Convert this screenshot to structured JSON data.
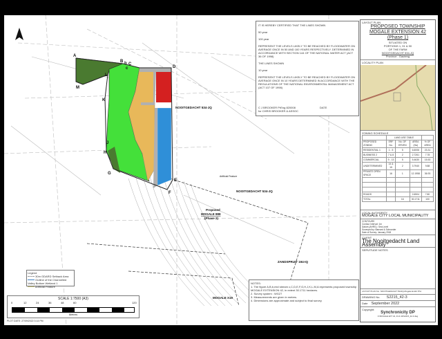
{
  "certificate": {
    "heading": "IT IS HEREBY CERTIFIED THAT THE LINES SHOWN",
    "line_50": "50   year",
    "line_100": "100   year",
    "text1": "REPRESENT THE LEVELS LIKELY TO BE REACHED BY FLOODWATER ON AVERAGE ONCE IN 50 AND 100 YEARS RESPECTIVELY. DETERMINED IN ACCORDANCE WITH SECTION 144 OF THE NATIONAL WATER ACT (ACT 36 OF 1998)",
    "lines_shown": "THE LINES SHOWN",
    "line_10": "10   year",
    "text2": "REPRESENT THE LEVELS LIKELY TO BE REACHED BY FLOODWATER ON AVERAGE ONCE IN 10 YEARS DETERMINED IN ACCORDANCE WITH THE REGULATIONS OF THE NATIONAL ENVIRONMENTAL MANAGEMENT ACT (ACT 107 OF 1998)",
    "signatory": "C J BROOKER PrEng 820008",
    "signatory_firm": "for CHRIS BROOKER & ASSOC",
    "date_label": "DATE"
  },
  "title_block": {
    "layout_plan_label": "LAYOUT PLAN",
    "title1": "PROPOSED TOWNSHIP",
    "title2": "MOGALE EXTENSION 42",
    "phase": "(Phase 1)",
    "situated": "SITUATED ON",
    "portions": "PORTIONS 1, 91 & 90",
    "farm": "OF THE FARM",
    "farm_name": "NOOITGEDACHT 534-JQ",
    "province": "Province : Gauteng",
    "locality_plan_label": "LOCALITY PLAN"
  },
  "zoning": {
    "heading": "ZONING SCHEDULE",
    "group_header": "LAND USE TABLE",
    "columns": [
      "PROPOSED ZONING",
      "ERF No.",
      "No. OF ERVEN",
      "AREA (Ha)",
      "% OF AREA"
    ],
    "rows": [
      [
        "RESIDENTIAL 1",
        "1 - 5",
        "5",
        "6.6006",
        "23.31"
      ],
      [
        "BUSINESS 2",
        "7 & 8",
        "2",
        "2.7261",
        "7.78"
      ],
      [
        "COMMERCIAL",
        "9 - 13",
        "5",
        "5.4630",
        "15.53"
      ],
      [
        "UNDETERMINED",
        "14 & 15",
        "2",
        "3.7940",
        "9.88"
      ],
      [
        "PRIVATE OPEN SPACE",
        "16",
        "1",
        "12.1958",
        "36.93"
      ]
    ],
    "roads": [
      "ROADS",
      "",
      "",
      "2.6504",
      "7.80"
    ],
    "total": [
      "TOTAL",
      "",
      "16",
      "30.1711",
      "100"
    ]
  },
  "authority": {
    "label": "LOCAL AUTHORITY",
    "name": "MOGALE CITY LOCAL MUNICIPALITY",
    "contours_label": "CONTOURS",
    "contour_rows": [
      [
        "Contour Interval:",
        "1m"
      ],
      [
        "Datum (AHRS.):",
        "Sea Level"
      ],
      [
        "Surveyed by:",
        "Barnard & Schroeder"
      ],
      [
        "Date of Survey:",
        "January 2018"
      ]
    ]
  },
  "client": {
    "label": "CLIENT",
    "name": "The Nooitgedacht Land Assembly",
    "servitude_label": "SERVITUDE NOTES"
  },
  "drawing": {
    "layout_plan_no_label": "LAYOUT PLAN No.",
    "layout_plan_no": "NOOITGEDACHT 534JQ-Mogale Ext42 Ph1",
    "drawing_no_label": "DRAWING No.",
    "drawing_no": "S2215_42-3",
    "date_label": "Date",
    "date": "September 2022",
    "copyright_label": "Copyright:",
    "company": "Synchronicity DP",
    "file_ref": "F:\\MOGALE EXT 42, 43 & 44\\S2215_42-3.dwg"
  },
  "notes": {
    "heading": "NOTES:",
    "items": [
      "1.  The figure A,B,b,mid stream c,C,D,E,F,G,H,J,K,L,M,A represents proposed township MOGALE EXTENSION 42, in extent 30.1711 hectares.",
      "2.  Survey system :  WG27",
      "3.  Measurements are given in metres.",
      "4.  Dimensions are approximate and subject to final survey."
    ]
  },
  "legend": {
    "heading": "Legend",
    "items": [
      {
        "label": "30m GDARD Setback Area",
        "color": "#999999"
      },
      {
        "label": "Outline of the Channelled Valley Bottom Wetland 1",
        "color": "#3a7fc0"
      },
      {
        "label": "Artificial Feature",
        "color": "#c9c27a"
      }
    ]
  },
  "scale": {
    "title": "SCALE 1:7500 (A3)",
    "ticks": [
      "0",
      "12",
      "24",
      "36",
      "48",
      "60",
      "120"
    ],
    "unit": "Metres"
  },
  "plot_date": "PLOT DATE: 27/09/2022 3:14 PM",
  "map": {
    "points": [
      "A",
      "B",
      "b",
      "C",
      "c",
      "D",
      "E",
      "F",
      "G",
      "H",
      "J",
      "K",
      "L",
      "M"
    ],
    "farm_labels": [
      "NOOITGEDACHT 534-JQ",
      "NOOITGEDACHT 534-JQ",
      "ZANDSPRUIT 194-IQ",
      "MOGALE X19"
    ],
    "proposed": [
      "Proposed",
      "MOGALE 888",
      "(Phase 2)"
    ],
    "artificial_feature": "Artificial Feature",
    "colors": {
      "residential": "#e8b85a",
      "business": "#d42020",
      "commercial": "#2f8fd8",
      "open_space": "#44e03a",
      "undetermined": "#4a7a30",
      "roads": "#b0b0b0"
    }
  }
}
